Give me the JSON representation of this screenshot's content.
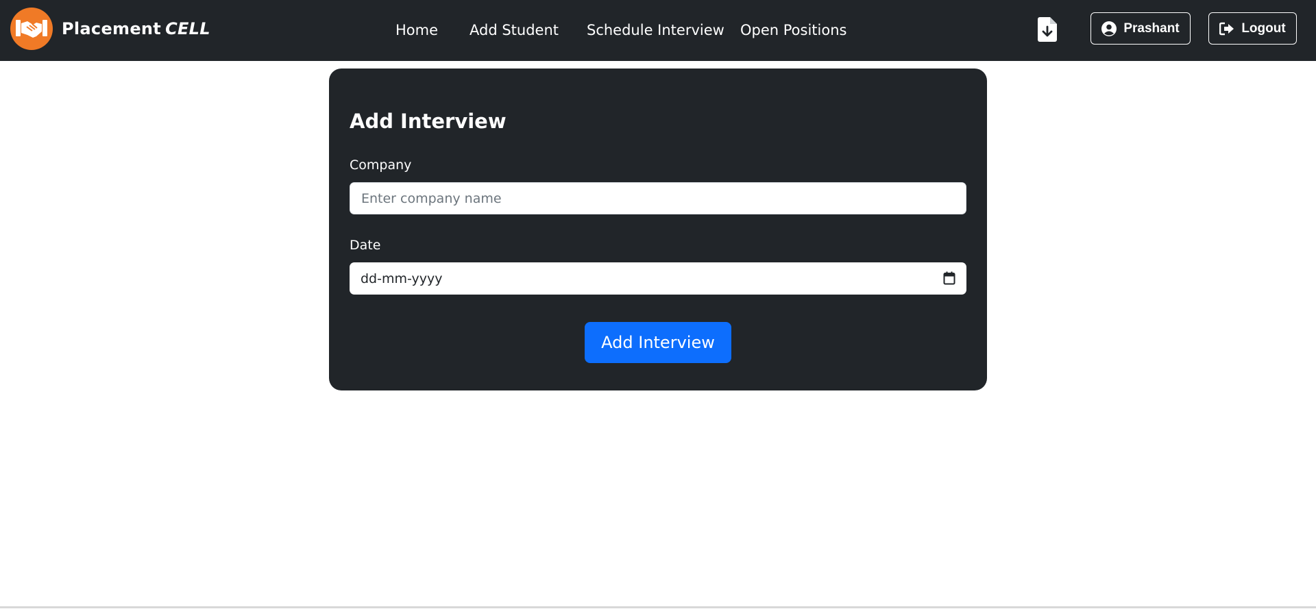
{
  "navbar": {
    "brand": {
      "name": "Placement",
      "suffix": "CELL"
    },
    "links": [
      {
        "label": "Home"
      },
      {
        "label": "Add Student"
      },
      {
        "label": "Schedule Interview"
      },
      {
        "label": "Open Positions"
      }
    ],
    "user_label": "Prashant",
    "logout_label": "Logout",
    "icons": {
      "download": "file-download-icon",
      "user": "user-circle-icon",
      "logout": "logout-icon",
      "logo": "handshake-icon"
    }
  },
  "form": {
    "title": "Add Interview",
    "company_label": "Company",
    "company_value": "",
    "company_placeholder": "Enter company name",
    "date_label": "Date",
    "date_value": "dd-mm-yyyy",
    "submit_label": "Add Interview"
  },
  "colors": {
    "navbar_bg": "#212529",
    "logo_bg": "#f07a26",
    "primary": "#0d6efd"
  }
}
